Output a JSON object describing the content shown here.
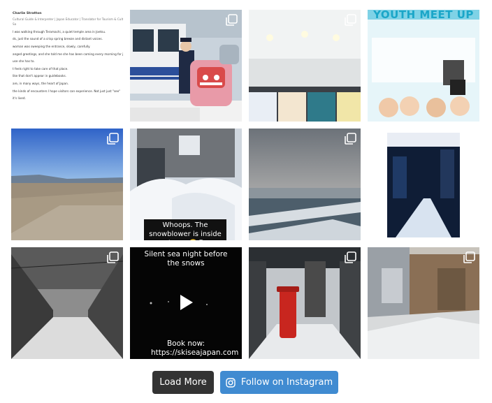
{
  "doc_post": {
    "author": "Charlie Stratton",
    "subtitle": "Cultural Guide & Interpreter | Japan Educator | Translator for Tourism & Cultural Project",
    "subtitle2": "Sa",
    "lines": [
      "I was walking through Teramachi, a quiet temple area in Joetsu.",
      "ds, just the sound of a crisp spring breeze and distant voices.",
      "woman was sweeping the entrance, slowly, carefully.",
      "anged greetings, and she told me she has been coming every morning for j",
      "use she has to.",
      "t feels right to take care of that place.",
      "like that don't appear in guidebooks.",
      "are, in many ways, the heart of Japan.",
      "the kinds of encounters I hope visitors can experience. Not just just \"see\"",
      "it's lived."
    ]
  },
  "poster_post": {
    "title": "YOUTH MEET UP"
  },
  "snowblower_post": {
    "caption": "Whoops. The snowblower is inside there. 😬😅"
  },
  "video_post": {
    "top_text": "Silent sea night before the snows",
    "bottom_text": "Book now: https://skiseajapan.com"
  },
  "buttons": {
    "load_more": "Load More",
    "follow": "Follow on Instagram"
  },
  "icons": {
    "multi": "multiple-images-icon",
    "play": "play-icon",
    "instagram": "instagram-icon"
  },
  "colors": {
    "load_more_bg": "#333333",
    "follow_bg": "#408bd1"
  }
}
